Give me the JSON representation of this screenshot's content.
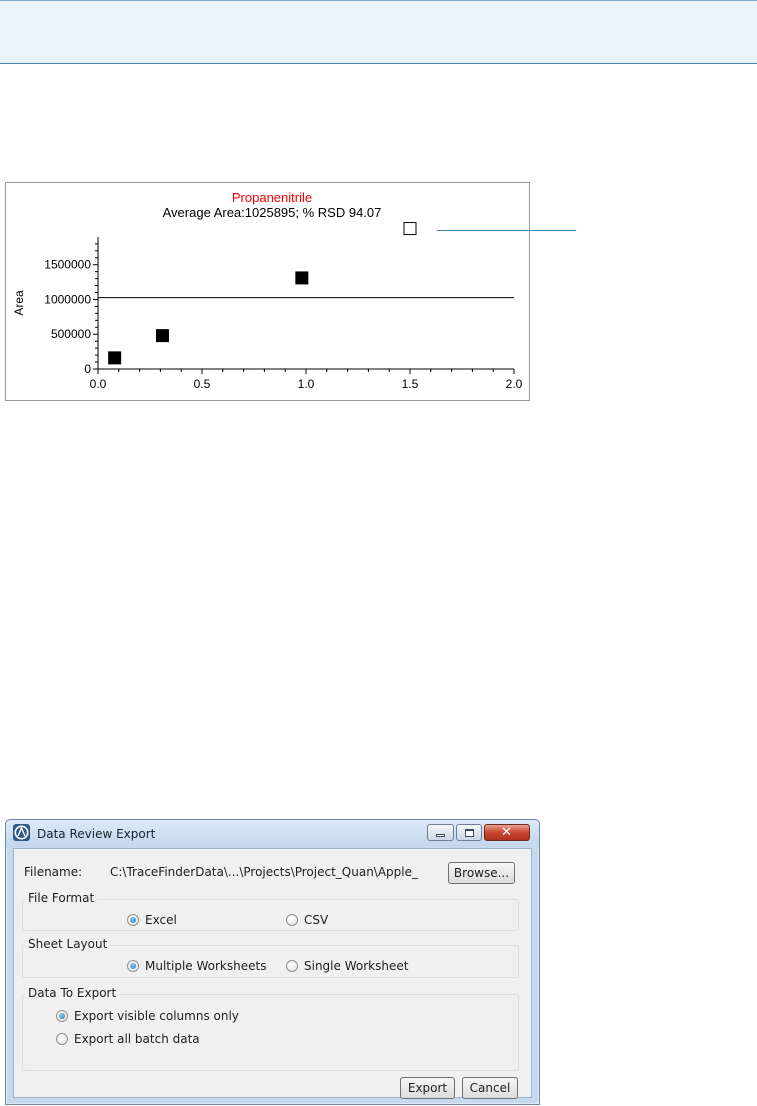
{
  "chart_data": {
    "type": "scatter",
    "title": "Propanenitrile",
    "subtitle": "Average Area:1025895; % RSD 94.07",
    "xlabel": "",
    "ylabel": "Area",
    "xlim": [
      0,
      2.0
    ],
    "ylim": [
      0,
      2100000
    ],
    "xticks": [
      "0.0",
      "0.5",
      "1.0",
      "1.5",
      "2.0"
    ],
    "yticks": [
      "0",
      "500000",
      "1000000",
      "1500000"
    ],
    "average_line": 1025895,
    "points": [
      {
        "x": 0.08,
        "y": 160000,
        "filled": true
      },
      {
        "x": 0.31,
        "y": 480000,
        "filled": true
      },
      {
        "x": 0.98,
        "y": 1310000,
        "filled": true
      },
      {
        "x": 1.5,
        "y": 2020000,
        "filled": false
      }
    ],
    "colors": {
      "title": "#ff0000",
      "text": "#000000"
    }
  },
  "dialog": {
    "title": "Data Review Export",
    "filename_label": "Filename:",
    "filename_value": "C:\\TraceFinderData\\...\\Projects\\Project_Quan\\Apple_",
    "browse_label": "Browse...",
    "file_format": {
      "title": "File Format",
      "options": [
        {
          "label": "Excel",
          "checked": true
        },
        {
          "label": "CSV",
          "checked": false
        }
      ]
    },
    "sheet_layout": {
      "title": "Sheet Layout",
      "options": [
        {
          "label": "Multiple Worksheets",
          "checked": true
        },
        {
          "label": "Single Worksheet",
          "checked": false
        }
      ]
    },
    "data_to_export": {
      "title": "Data To Export",
      "options": [
        {
          "label": "Export visible columns only",
          "checked": true
        },
        {
          "label": "Export all batch data",
          "checked": false
        }
      ]
    },
    "export_label": "Export",
    "cancel_label": "Cancel"
  }
}
